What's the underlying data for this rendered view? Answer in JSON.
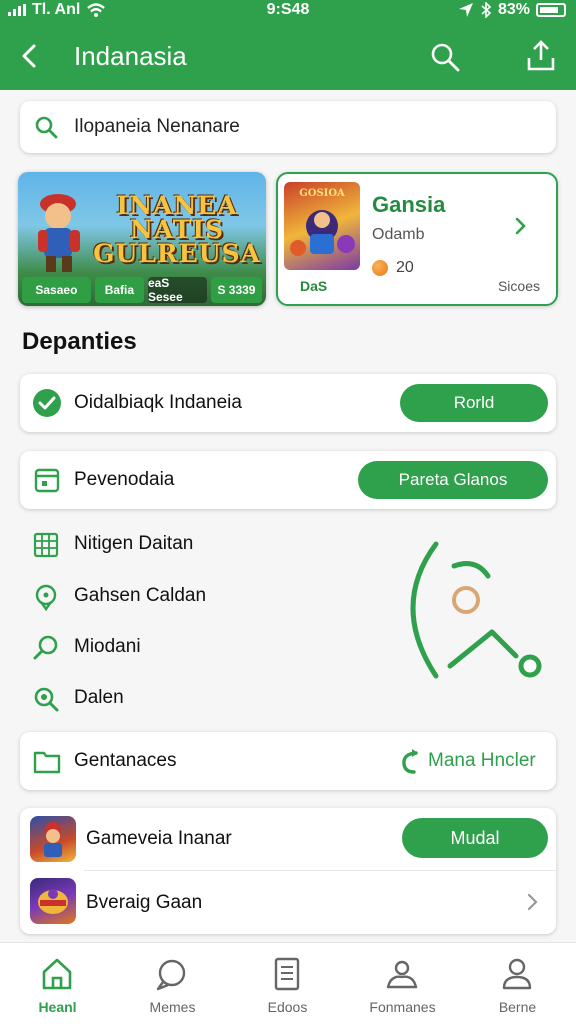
{
  "status_bar": {
    "carrier": "Tl. Anl",
    "time": "9:S48",
    "battery": "83%"
  },
  "app_bar": {
    "title": "Indanasia"
  },
  "search": {
    "value": "Ilopaneia Nenanare"
  },
  "banner": {
    "title_line1": "INANEA",
    "title_line2": "NATIS",
    "title_line3": "GULREUSA",
    "tags": [
      "Sasaeo",
      "Bafia",
      "eaS Sesee",
      "S 3339"
    ]
  },
  "game_card": {
    "thumb_text": "GOSIOA",
    "name": "Gansia",
    "subtitle": "Odamb",
    "count": "20",
    "tag_left": "DaS",
    "tag_right": "Sicoes"
  },
  "section": {
    "title": "Depanties"
  },
  "rows": [
    {
      "label": "Oidalbiaqk Indaneia",
      "action": "Rorld"
    },
    {
      "label": "Pevenodaia",
      "action": "Pareta Glanos"
    }
  ],
  "list": [
    {
      "label": "Nitigen Daitan",
      "icon": "grid-icon"
    },
    {
      "label": "Gahsen Caldan",
      "icon": "location-pin-icon"
    },
    {
      "label": "Miodani",
      "icon": "search-icon"
    },
    {
      "label": "Dalen",
      "icon": "zoom-icon"
    }
  ],
  "folder_row": {
    "label": "Gentanaces",
    "action": "Mana Hncler"
  },
  "apps": [
    {
      "label": "Gameveia Inanar",
      "action": "Mudal"
    },
    {
      "label": "Bveraig Gaan"
    }
  ],
  "bottom_nav": [
    {
      "label": "Heanl",
      "icon": "home-icon",
      "active": true
    },
    {
      "label": "Memes",
      "icon": "chat-icon",
      "active": false
    },
    {
      "label": "Edoos",
      "icon": "document-icon",
      "active": false
    },
    {
      "label": "Fonmanes",
      "icon": "group-icon",
      "active": false
    },
    {
      "label": "Berne",
      "icon": "profile-icon",
      "active": false
    }
  ],
  "colors": {
    "accent": "#2fa04c",
    "accent_dark": "#248c3f",
    "background": "#f5f6f5"
  }
}
